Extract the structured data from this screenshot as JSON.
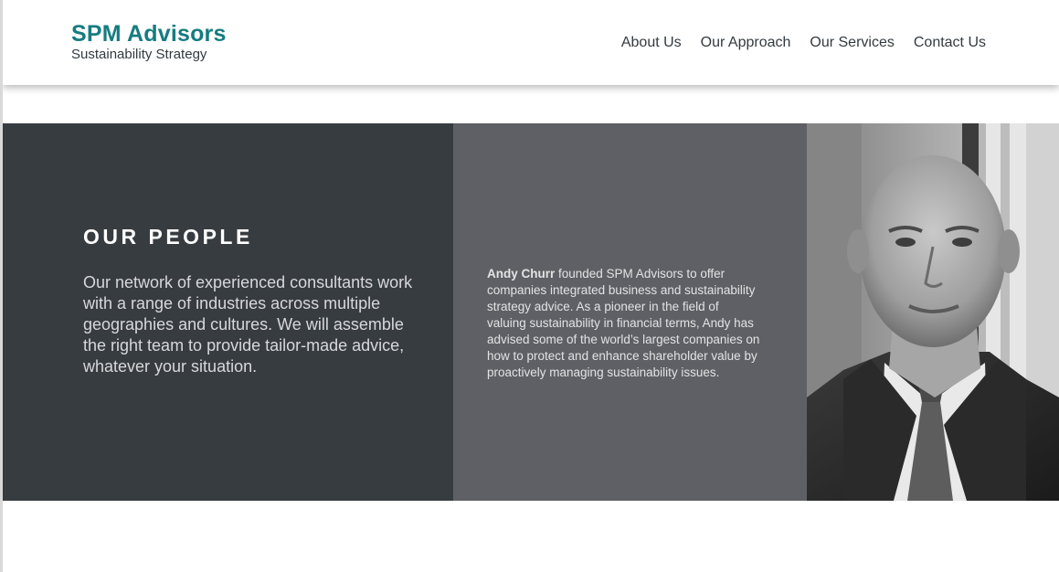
{
  "header": {
    "brand_title": "SPM Advisors",
    "brand_subtitle": "Sustainability Strategy",
    "brand_color": "#167c80",
    "nav": [
      {
        "label": "About Us"
      },
      {
        "label": "Our Approach"
      },
      {
        "label": "Our Services"
      },
      {
        "label": "Contact Us"
      }
    ]
  },
  "people": {
    "heading": "OUR PEOPLE",
    "intro": "Our network of experienced consultants work with a range of industries across multiple geographies and cultures. We will assemble the right team to provide tailor-made advice, whatever your situation.",
    "bio_name": "Andy Churr",
    "bio_text": " founded SPM Advisors to offer companies integrated business and sustainability strategy advice. As a pioneer in the field of valuing sustainability in financial terms, Andy has advised some of the world’s largest companies on how to protect and enhance shareholder value by proactively managing sustainability issues.",
    "photo": "portrait-photo"
  },
  "colors": {
    "panel_dark": "#373c41",
    "panel_mid": "#5f6065",
    "text_dark": "#333a3f"
  }
}
